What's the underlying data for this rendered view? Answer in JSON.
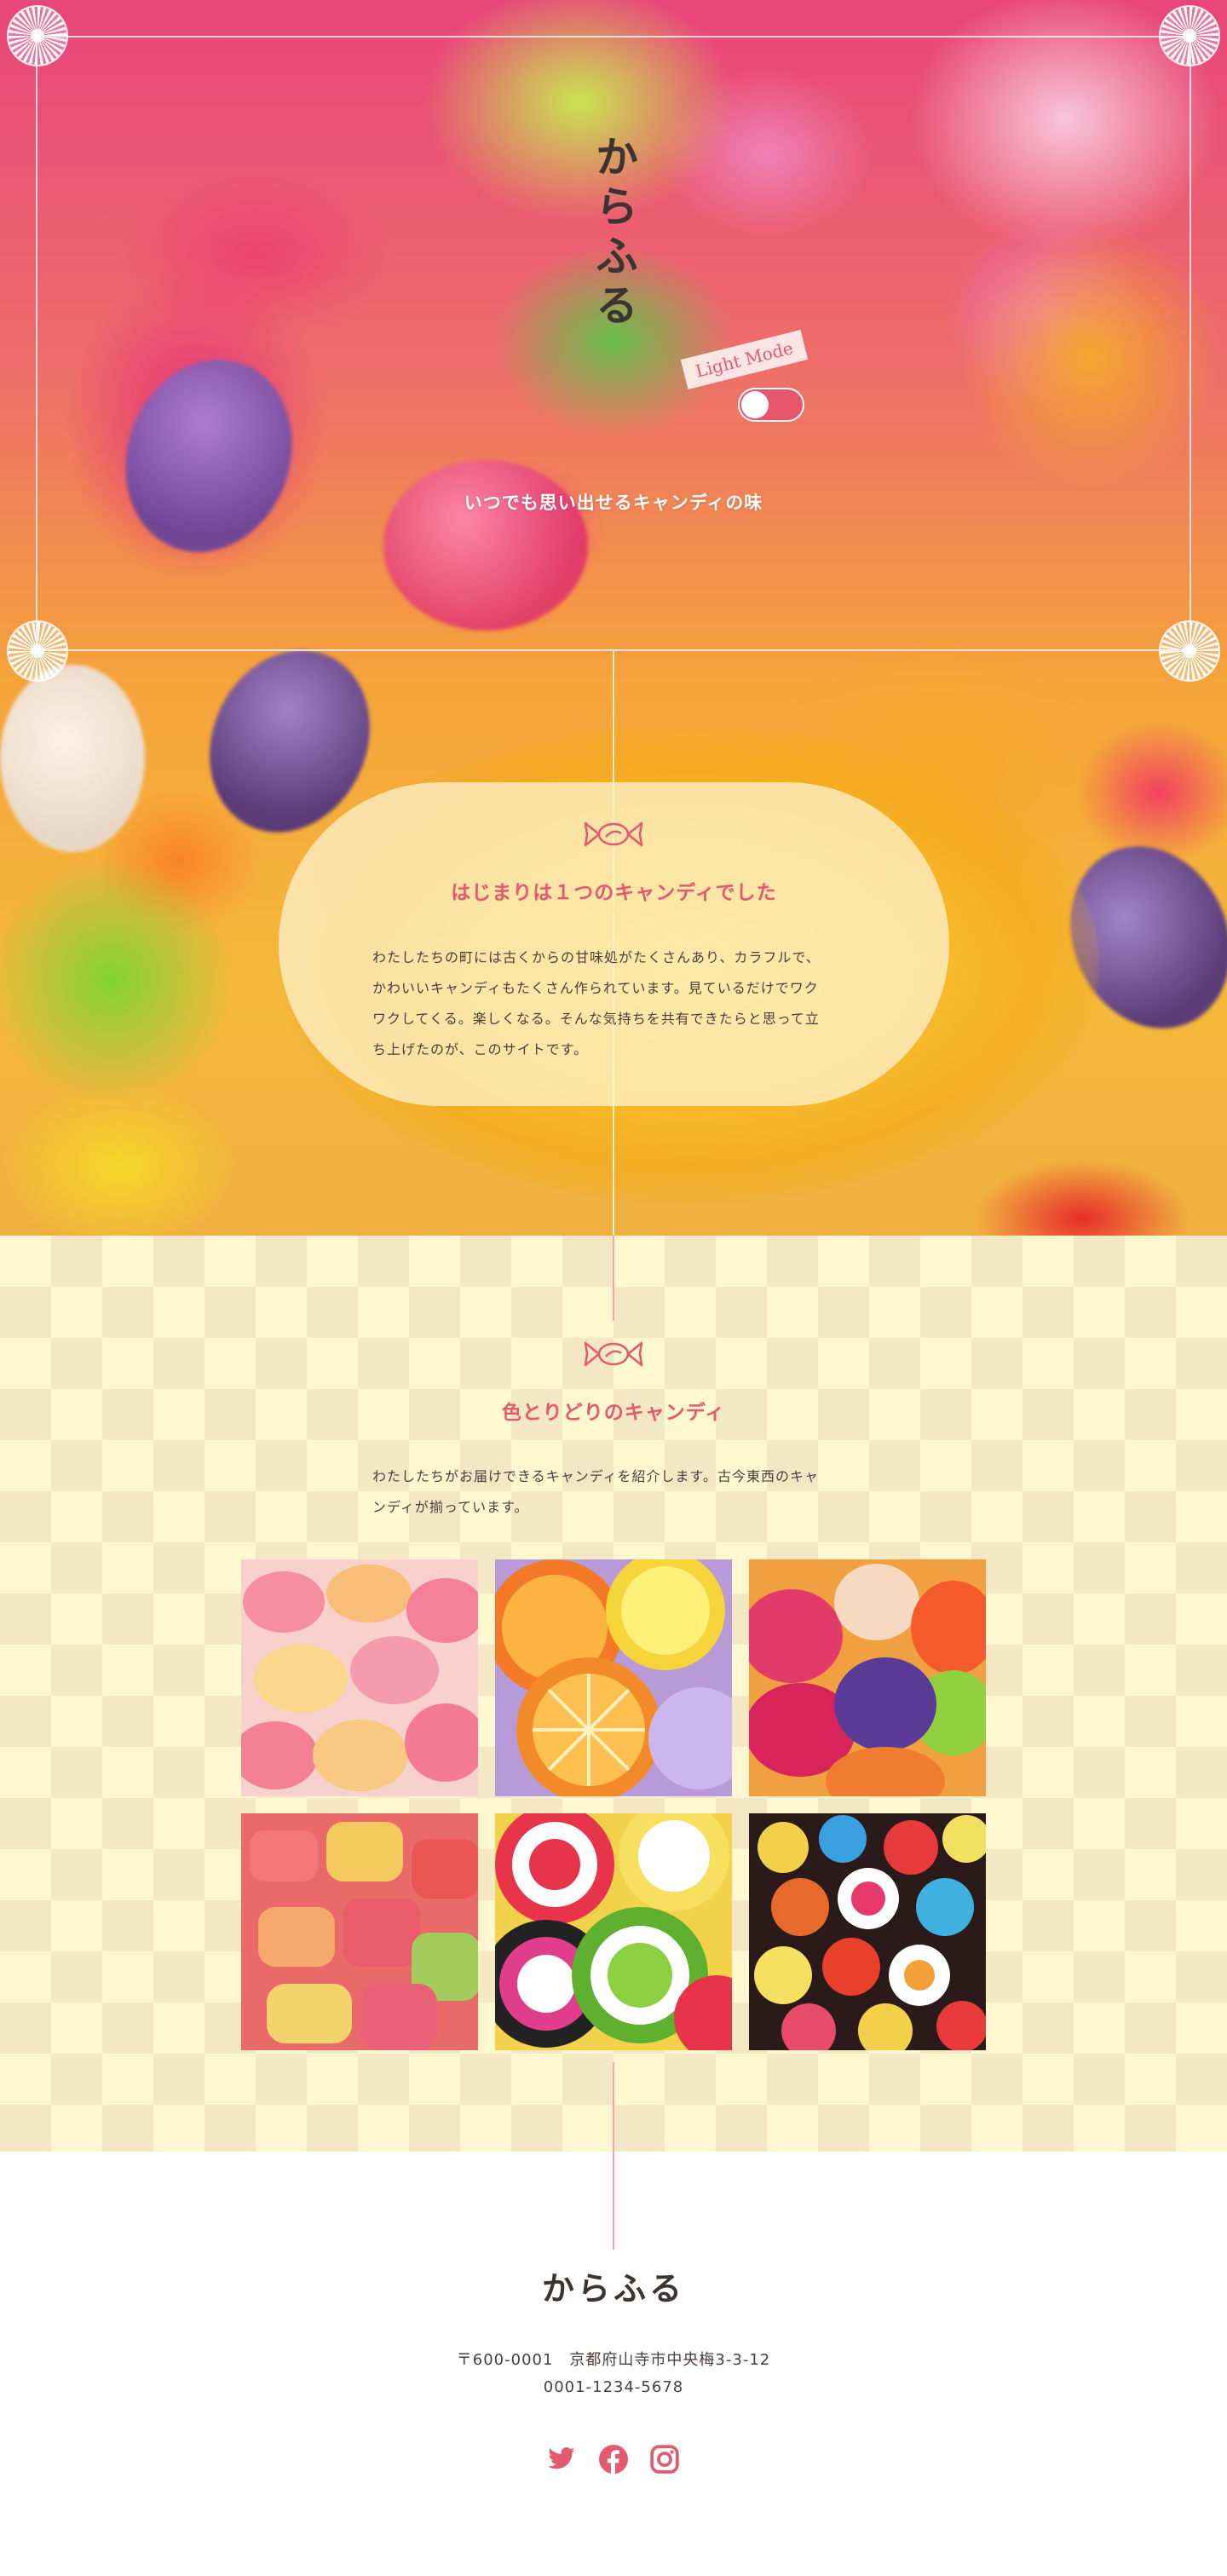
{
  "site": {
    "title": "からふる"
  },
  "hero": {
    "mode_label": "Light Mode",
    "tagline": "いつでも思い出せるキャンディの味"
  },
  "intro": {
    "heading": "はじまりは１つのキャンディでした",
    "lines": [
      "わたしたちの町には古くからの甘味処がたくさんあり、カラフルで、",
      "かわいいキャンディもたくさん作られています。見ているだけでワク",
      "ワクしてくる。楽しくなる。そんな気持ちを共有できたらと思って立",
      "ち上げたのが、このサイトです。"
    ]
  },
  "products": {
    "heading": "色とりどりのキャンディ",
    "lines": [
      "わたしたちがお届けできるキャンディを紹介します。古今東西のキャ",
      "ンディが揃っています。"
    ]
  },
  "footer": {
    "logo": "からふる",
    "address": "〒600-0001　京都府山寺市中央梅3-3-12",
    "phone": "0001-1234-5678",
    "social_icons": [
      "twitter-icon",
      "facebook-icon",
      "instagram-icon"
    ]
  },
  "colors": {
    "accent": "#e35a6e",
    "text": "#4a3f3a",
    "cream": "#fff7cf"
  }
}
